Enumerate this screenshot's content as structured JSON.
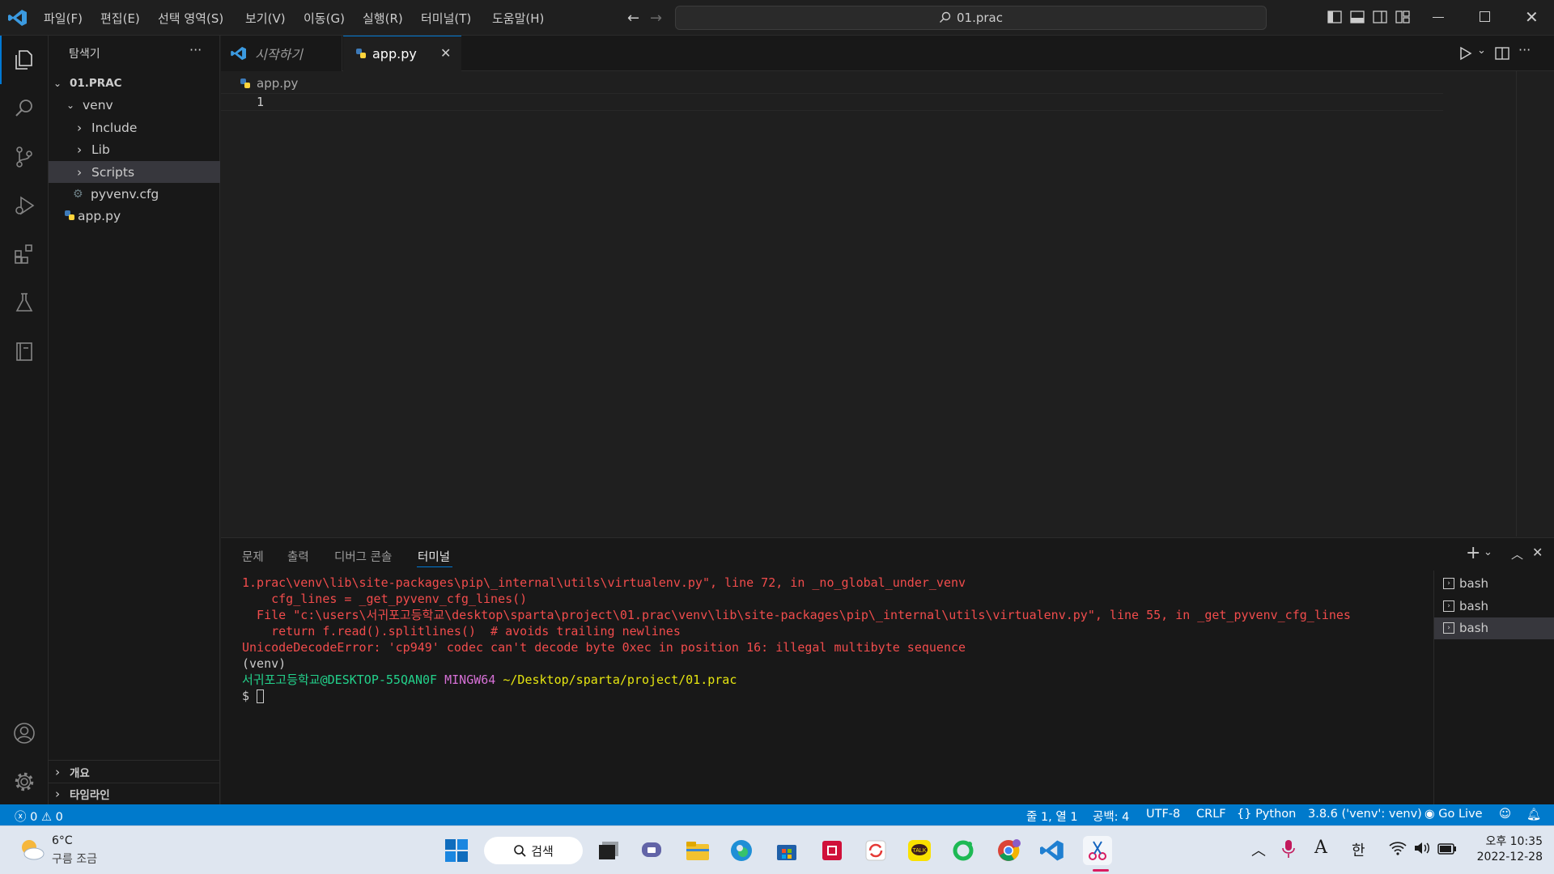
{
  "titlebar": {
    "menus": [
      "파일(F)",
      "편집(E)",
      "선택 영역(S)",
      "보기(V)",
      "이동(G)",
      "실행(R)",
      "터미널(T)",
      "도움말(H)"
    ],
    "search_text": "01.prac"
  },
  "sidebar": {
    "title": "탐색기",
    "more": "···",
    "root": "01.PRAC",
    "items": [
      {
        "label": "venv"
      },
      {
        "label": "Include"
      },
      {
        "label": "Lib"
      },
      {
        "label": "Scripts"
      },
      {
        "label": "pyvenv.cfg"
      },
      {
        "label": "app.py"
      }
    ],
    "outline": "개요",
    "timeline": "타임라인"
  },
  "tabs": [
    {
      "label": "시작하기"
    },
    {
      "label": "app.py"
    }
  ],
  "editor": {
    "breadcrumb": "app.py",
    "line_number": "1"
  },
  "panel": {
    "tabs": [
      "문제",
      "출력",
      "디버그 콘솔",
      "터미널"
    ],
    "active_tab": "터미널",
    "terminal_lines": [
      "1.prac\\venv\\lib\\site-packages\\pip\\_internal\\utils\\virtualenv.py\", line 72, in _no_global_under_venv",
      "    cfg_lines = _get_pyvenv_cfg_lines()",
      "  File \"c:\\users\\서귀포고등학교\\desktop\\sparta\\project\\01.prac\\venv\\lib\\site-packages\\pip\\_internal\\utils\\virtualenv.py\", line 55, in _get_pyvenv_cfg_lines",
      "    return f.read().splitlines()  # avoids trailing newlines",
      "UnicodeDecodeError: 'cp949' codec can't decode byte 0xec in position 16: illegal multibyte sequence"
    ],
    "venv_line": "(venv)",
    "prompt_user": "서귀포고등학교@DESKTOP-55QAN0F",
    "prompt_env": "MINGW64",
    "prompt_path": "~/Desktop/sparta/project/01.prac",
    "prompt_symbol": "$",
    "shells": [
      "bash",
      "bash",
      "bash"
    ]
  },
  "status": {
    "errors": "0",
    "warnings": "0",
    "position": "줄 1, 열 1",
    "spaces": "공백: 4",
    "encoding": "UTF-8",
    "eol": "CRLF",
    "language": "Python",
    "interpreter": "3.8.6 ('venv': venv)",
    "golive": "Go Live"
  },
  "taskbar": {
    "weather_temp": "6°C",
    "weather_desc": "구름 조금",
    "search_label": "검색",
    "ime_a": "A",
    "ime_han": "한",
    "time": "오후 10:35",
    "date": "2022-12-28"
  },
  "colors": {
    "accent": "#007acc",
    "error": "#f14c4c",
    "prompt_green": "#23d18b",
    "prompt_magenta": "#d670d6",
    "prompt_yellow": "#e5e510"
  }
}
